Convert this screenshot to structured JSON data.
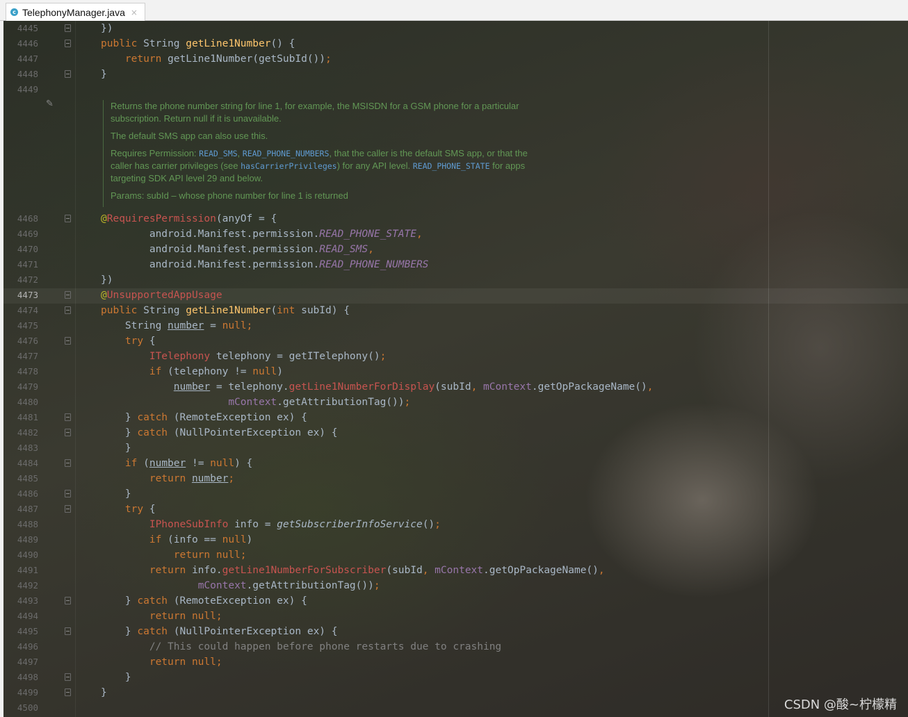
{
  "tab": {
    "title": "TelephonyManager.java",
    "icon": "java-class-icon",
    "close": "×"
  },
  "doc": {
    "p1": "Returns the phone number string for line 1, for example, the MSISDN for a GSM phone for a particular subscription. Return null if it is unavailable.",
    "p2": "The default SMS app can also use this.",
    "p3_a": "Requires Permission: ",
    "p3_perm1": "READ_SMS",
    "p3_b": ", ",
    "p3_perm2": "READ_PHONE_NUMBERS",
    "p3_c": ", that the caller is the default SMS app, or that the caller has carrier privileges (see ",
    "p3_link": "hasCarrierPrivileges",
    "p3_d": ") for any API level. ",
    "p3_perm3": "READ_PHONE_STATE",
    "p3_e": " for apps targeting SDK API level 29 and below.",
    "p4": "Params: subId – whose phone number for line 1 is returned"
  },
  "lines": [
    {
      "n": "4445",
      "fold": true,
      "segs": [
        [
          "p",
          "})"
        ]
      ]
    },
    {
      "n": "4446",
      "fold": true,
      "segs": [
        [
          "kw",
          "public "
        ],
        [
          "p",
          "String "
        ],
        [
          "met",
          "getLine1Number"
        ],
        [
          "p",
          "() {"
        ]
      ]
    },
    {
      "n": "4447",
      "fold": false,
      "segs": [
        [
          "p",
          "    "
        ],
        [
          "kw",
          "return "
        ],
        [
          "p",
          "getLine1Number(getSubId())"
        ],
        [
          "kw",
          ";"
        ]
      ]
    },
    {
      "n": "4448",
      "fold": true,
      "segs": [
        [
          "p",
          "}"
        ]
      ]
    },
    {
      "n": "4449",
      "fold": false,
      "segs": []
    },
    {
      "n": "4468",
      "fold": true,
      "segs": [
        [
          "ann",
          "@"
        ],
        [
          "err",
          "RequiresPermission"
        ],
        [
          "p",
          "(anyOf = {"
        ]
      ]
    },
    {
      "n": "4469",
      "fold": false,
      "segs": [
        [
          "p",
          "        android.Manifest.permission."
        ],
        [
          "fi",
          "READ_PHONE_STATE"
        ],
        [
          "kw",
          ","
        ]
      ]
    },
    {
      "n": "4470",
      "fold": false,
      "segs": [
        [
          "p",
          "        android.Manifest.permission."
        ],
        [
          "fi",
          "READ_SMS"
        ],
        [
          "kw",
          ","
        ]
      ]
    },
    {
      "n": "4471",
      "fold": false,
      "segs": [
        [
          "p",
          "        android.Manifest.permission."
        ],
        [
          "fi",
          "READ_PHONE_NUMBERS"
        ]
      ]
    },
    {
      "n": "4472",
      "fold": false,
      "segs": [
        [
          "p",
          "})"
        ]
      ]
    },
    {
      "n": "4473",
      "fold": true,
      "cur": true,
      "segs": [
        [
          "ann",
          "@"
        ],
        [
          "err",
          "UnsupportedAppUsage"
        ]
      ]
    },
    {
      "n": "4474",
      "fold": true,
      "segs": [
        [
          "kw",
          "public "
        ],
        [
          "p",
          "String "
        ],
        [
          "met",
          "getLine1Number"
        ],
        [
          "p",
          "("
        ],
        [
          "kw",
          "int "
        ],
        [
          "p",
          "subId) {"
        ]
      ]
    },
    {
      "n": "4475",
      "fold": false,
      "segs": [
        [
          "p",
          "    String "
        ],
        [
          "u",
          "number"
        ],
        [
          "p",
          " = "
        ],
        [
          "kw",
          "null;"
        ]
      ]
    },
    {
      "n": "4476",
      "fold": true,
      "segs": [
        [
          "p",
          "    "
        ],
        [
          "kw",
          "try "
        ],
        [
          "p",
          "{"
        ]
      ]
    },
    {
      "n": "4477",
      "fold": false,
      "segs": [
        [
          "p",
          "        "
        ],
        [
          "err",
          "ITelephony "
        ],
        [
          "p",
          "telephony = getITelephony()"
        ],
        [
          "kw",
          ";"
        ]
      ]
    },
    {
      "n": "4478",
      "fold": false,
      "segs": [
        [
          "p",
          "        "
        ],
        [
          "kw",
          "if "
        ],
        [
          "p",
          "(telephony != "
        ],
        [
          "kw",
          "null"
        ],
        [
          "p",
          ")"
        ]
      ]
    },
    {
      "n": "4479",
      "fold": false,
      "segs": [
        [
          "p",
          "            "
        ],
        [
          "u",
          "number"
        ],
        [
          "p",
          " = telephony."
        ],
        [
          "err",
          "getLine1NumberForDisplay"
        ],
        [
          "p",
          "(subId"
        ],
        [
          "kw",
          ", "
        ],
        [
          "fld",
          "mContext"
        ],
        [
          "p",
          ".getOpPackageName()"
        ],
        [
          "kw",
          ","
        ]
      ]
    },
    {
      "n": "4480",
      "fold": false,
      "segs": [
        [
          "p",
          "                     "
        ],
        [
          "fld",
          "mContext"
        ],
        [
          "p",
          ".getAttributionTag())"
        ],
        [
          "kw",
          ";"
        ]
      ]
    },
    {
      "n": "4481",
      "fold": true,
      "segs": [
        [
          "p",
          "    } "
        ],
        [
          "kw",
          "catch "
        ],
        [
          "p",
          "(RemoteException ex) {"
        ]
      ]
    },
    {
      "n": "4482",
      "fold": true,
      "segs": [
        [
          "p",
          "    } "
        ],
        [
          "kw",
          "catch "
        ],
        [
          "p",
          "(NullPointerException ex) {"
        ]
      ]
    },
    {
      "n": "4483",
      "fold": false,
      "segs": [
        [
          "p",
          "    }"
        ]
      ]
    },
    {
      "n": "4484",
      "fold": true,
      "segs": [
        [
          "p",
          "    "
        ],
        [
          "kw",
          "if "
        ],
        [
          "p",
          "("
        ],
        [
          "u",
          "number"
        ],
        [
          "p",
          " != "
        ],
        [
          "kw",
          "null"
        ],
        [
          "p",
          ") {"
        ]
      ]
    },
    {
      "n": "4485",
      "fold": false,
      "segs": [
        [
          "p",
          "        "
        ],
        [
          "kw",
          "return "
        ],
        [
          "u",
          "number"
        ],
        [
          "kw",
          ";"
        ]
      ]
    },
    {
      "n": "4486",
      "fold": true,
      "segs": [
        [
          "p",
          "    }"
        ]
      ]
    },
    {
      "n": "4487",
      "fold": true,
      "segs": [
        [
          "p",
          "    "
        ],
        [
          "kw",
          "try "
        ],
        [
          "p",
          "{"
        ]
      ]
    },
    {
      "n": "4488",
      "fold": false,
      "segs": [
        [
          "p",
          "        "
        ],
        [
          "err",
          "IPhoneSubInfo "
        ],
        [
          "p",
          "info = "
        ],
        [
          "i",
          "getSubscriberInfoService"
        ],
        [
          "p",
          "()"
        ],
        [
          "kw",
          ";"
        ]
      ]
    },
    {
      "n": "4489",
      "fold": false,
      "segs": [
        [
          "p",
          "        "
        ],
        [
          "kw",
          "if "
        ],
        [
          "p",
          "(info == "
        ],
        [
          "kw",
          "null"
        ],
        [
          "p",
          ")"
        ]
      ]
    },
    {
      "n": "4490",
      "fold": false,
      "segs": [
        [
          "p",
          "            "
        ],
        [
          "kw",
          "return null;"
        ]
      ]
    },
    {
      "n": "4491",
      "fold": false,
      "segs": [
        [
          "p",
          "        "
        ],
        [
          "kw",
          "return "
        ],
        [
          "p",
          "info."
        ],
        [
          "err",
          "getLine1NumberForSubscriber"
        ],
        [
          "p",
          "(subId"
        ],
        [
          "kw",
          ", "
        ],
        [
          "fld",
          "mContext"
        ],
        [
          "p",
          ".getOpPackageName()"
        ],
        [
          "kw",
          ","
        ]
      ]
    },
    {
      "n": "4492",
      "fold": false,
      "segs": [
        [
          "p",
          "                "
        ],
        [
          "fld",
          "mContext"
        ],
        [
          "p",
          ".getAttributionTag())"
        ],
        [
          "kw",
          ";"
        ]
      ]
    },
    {
      "n": "4493",
      "fold": true,
      "segs": [
        [
          "p",
          "    } "
        ],
        [
          "kw",
          "catch "
        ],
        [
          "p",
          "(RemoteException ex) {"
        ]
      ]
    },
    {
      "n": "4494",
      "fold": false,
      "segs": [
        [
          "p",
          "        "
        ],
        [
          "kw",
          "return null;"
        ]
      ]
    },
    {
      "n": "4495",
      "fold": true,
      "segs": [
        [
          "p",
          "    } "
        ],
        [
          "kw",
          "catch "
        ],
        [
          "p",
          "(NullPointerException ex) {"
        ]
      ]
    },
    {
      "n": "4496",
      "fold": false,
      "segs": [
        [
          "cmt",
          "        // This could happen before phone restarts due to crashing"
        ]
      ]
    },
    {
      "n": "4497",
      "fold": false,
      "segs": [
        [
          "p",
          "        "
        ],
        [
          "kw",
          "return null;"
        ]
      ]
    },
    {
      "n": "4498",
      "fold": true,
      "segs": [
        [
          "p",
          "    }"
        ]
      ]
    },
    {
      "n": "4499",
      "fold": true,
      "segs": [
        [
          "p",
          "}"
        ]
      ]
    },
    {
      "n": "4500",
      "fold": false,
      "segs": []
    }
  ],
  "watermark": "CSDN @酸~柠檬精"
}
